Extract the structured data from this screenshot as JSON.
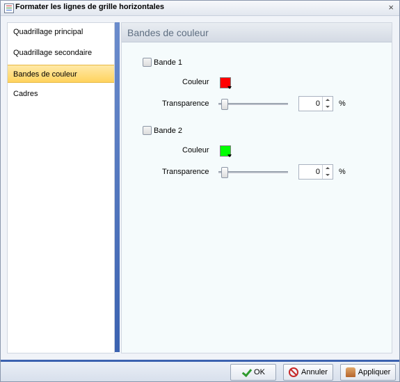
{
  "window": {
    "title": "Formater les lignes de grille horizontales",
    "close_glyph": "×"
  },
  "nav": {
    "items": [
      {
        "label": "Quadrillage principal",
        "selected": false
      },
      {
        "label": "Quadrillage secondaire",
        "selected": false
      },
      {
        "label": "Bandes de couleur",
        "selected": true
      },
      {
        "label": "Cadres",
        "selected": false
      }
    ]
  },
  "panel": {
    "title": "Bandes de couleur",
    "bands": [
      {
        "checkbox_label": "Bande 1",
        "checked": false,
        "color_label": "Couleur",
        "color": "#ff0000",
        "transparency_label": "Transparence",
        "transparency_value": "0",
        "unit": "%"
      },
      {
        "checkbox_label": "Bande 2",
        "checked": false,
        "color_label": "Couleur",
        "color": "#00ff00",
        "transparency_label": "Transparence",
        "transparency_value": "0",
        "unit": "%"
      }
    ]
  },
  "footer": {
    "ok_label": "OK",
    "cancel_label": "Annuler",
    "apply_label": "Appliquer"
  },
  "colors": {
    "accent": "#3b62b0",
    "selected_item": "#ffd35e"
  }
}
